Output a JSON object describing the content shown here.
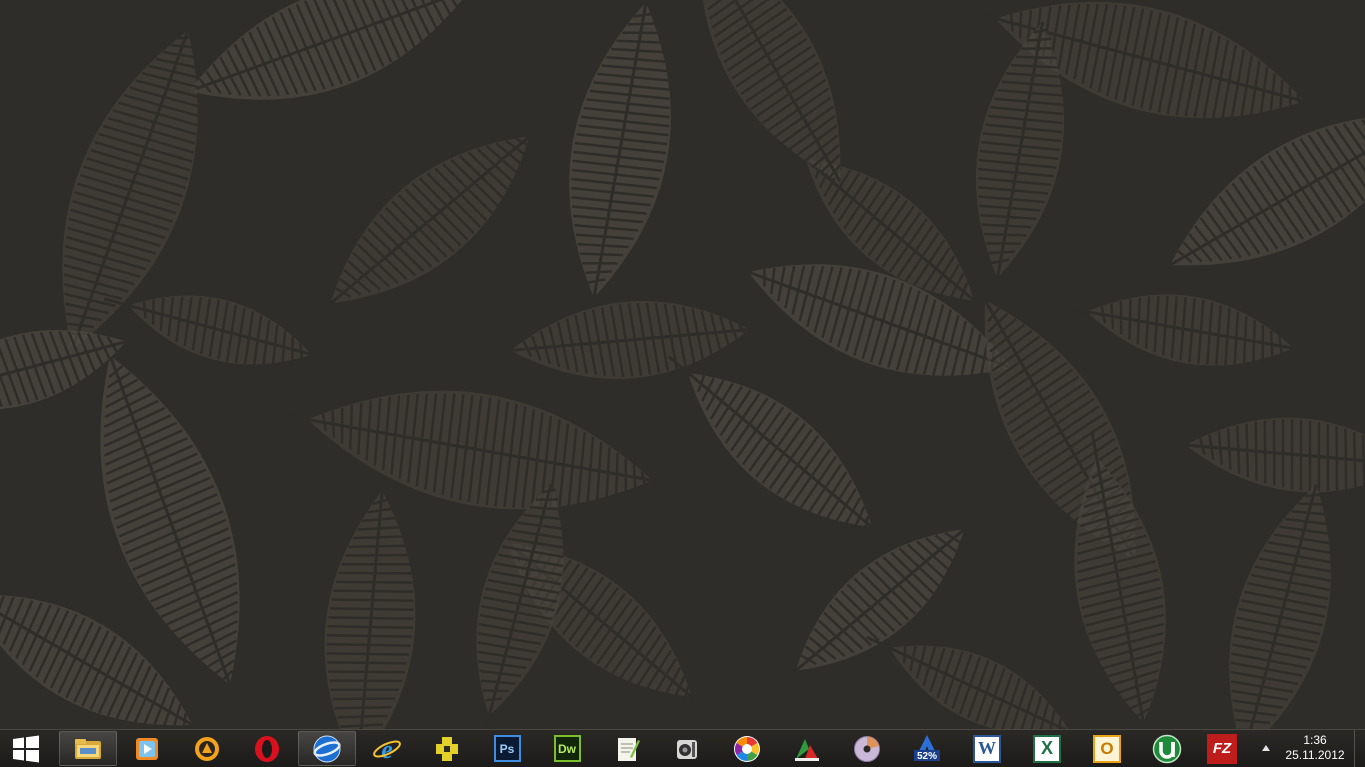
{
  "desktop": {
    "wallpaper": "dark-leaves-pattern",
    "colors": {
      "background": "#2f2d29",
      "leaf": "#4a4740",
      "leaf_light": "#55524a"
    }
  },
  "taskbar": {
    "start_icon": "windows-logo-icon",
    "apps": [
      {
        "icon": "file-explorer-icon",
        "active": true
      },
      {
        "icon": "media-player-icon",
        "active": false
      },
      {
        "icon": "aimp-player-icon",
        "active": false
      },
      {
        "icon": "opera-icon",
        "active": false
      },
      {
        "icon": "browser-globe-icon",
        "active": true
      },
      {
        "icon": "internet-explorer-icon",
        "active": false
      },
      {
        "icon": "app-yellow-icon",
        "active": false
      },
      {
        "icon": "photoshop-icon",
        "text": "Ps",
        "active": false
      },
      {
        "icon": "dreamweaver-icon",
        "text": "Dw",
        "active": false
      },
      {
        "icon": "notepad-plus-plus-icon",
        "active": false
      },
      {
        "icon": "speaker-app-icon",
        "active": false
      },
      {
        "icon": "picasa-icon",
        "active": false
      },
      {
        "icon": "chart-app-icon",
        "active": false
      },
      {
        "icon": "disc-burner-icon",
        "active": false
      },
      {
        "icon": "download-accelerator-icon",
        "text": "52%",
        "active": false
      },
      {
        "icon": "word-icon",
        "text": "W",
        "active": false
      },
      {
        "icon": "excel-icon",
        "text": "X",
        "active": false
      },
      {
        "icon": "outlook-icon",
        "text": "O",
        "active": false
      },
      {
        "icon": "utorrent-icon",
        "active": false
      },
      {
        "icon": "filezilla-icon",
        "text": "FZ",
        "active": false
      }
    ],
    "tray": {
      "arrow_icon": "show-hidden-icons-icon",
      "time": "1:36",
      "date": "25.11.2012"
    }
  }
}
